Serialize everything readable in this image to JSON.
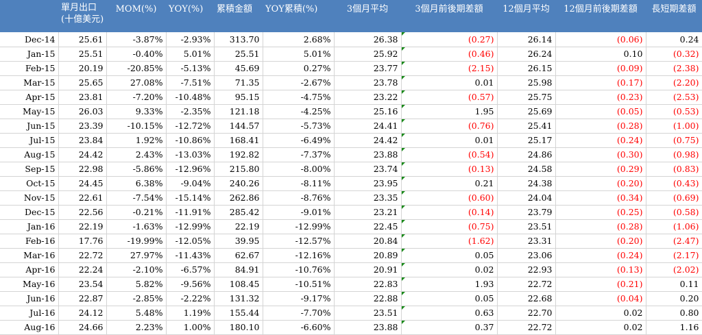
{
  "headers": [
    "",
    "單月出口\n(十億美元)",
    "MOM(%)",
    "YOY(%)",
    "累積金額",
    "YOY累積(%)",
    "3個月平均",
    "3個月前後期差額",
    "12個月平均",
    "12個月前後期差額",
    "長短期差額"
  ],
  "rows": [
    {
      "date": "Dec-14",
      "export": "25.61",
      "mom": "-3.87%",
      "yoy": "-2.93%",
      "cum": "313.70",
      "yoy_cum": "2.68%",
      "avg3": "26.38",
      "diff3": "(0.27)",
      "avg12": "26.14",
      "diff12": "(0.06)",
      "spread": "0.24"
    },
    {
      "date": "Jan-15",
      "export": "25.51",
      "mom": "-0.40%",
      "yoy": "5.01%",
      "cum": "25.51",
      "yoy_cum": "5.01%",
      "avg3": "25.92",
      "diff3": "(0.46)",
      "avg12": "26.24",
      "diff12": "0.10",
      "spread": "(0.32)"
    },
    {
      "date": "Feb-15",
      "export": "20.19",
      "mom": "-20.85%",
      "yoy": "-5.13%",
      "cum": "45.69",
      "yoy_cum": "0.27%",
      "avg3": "23.77",
      "diff3": "(2.15)",
      "avg12": "26.15",
      "diff12": "(0.09)",
      "spread": "(2.38)"
    },
    {
      "date": "Mar-15",
      "export": "25.65",
      "mom": "27.08%",
      "yoy": "-7.51%",
      "cum": "71.35",
      "yoy_cum": "-2.67%",
      "avg3": "23.78",
      "diff3": "0.01",
      "avg12": "25.98",
      "diff12": "(0.17)",
      "spread": "(2.20)"
    },
    {
      "date": "Apr-15",
      "export": "23.81",
      "mom": "-7.20%",
      "yoy": "-10.48%",
      "cum": "95.15",
      "yoy_cum": "-4.75%",
      "avg3": "23.22",
      "diff3": "(0.57)",
      "avg12": "25.75",
      "diff12": "(0.23)",
      "spread": "(2.53)"
    },
    {
      "date": "May-15",
      "export": "26.03",
      "mom": "9.33%",
      "yoy": "-2.35%",
      "cum": "121.18",
      "yoy_cum": "-4.25%",
      "avg3": "25.16",
      "diff3": "1.95",
      "avg12": "25.69",
      "diff12": "(0.05)",
      "spread": "(0.53)"
    },
    {
      "date": "Jun-15",
      "export": "23.39",
      "mom": "-10.15%",
      "yoy": "-12.72%",
      "cum": "144.57",
      "yoy_cum": "-5.73%",
      "avg3": "24.41",
      "diff3": "(0.76)",
      "avg12": "25.41",
      "diff12": "(0.28)",
      "spread": "(1.00)"
    },
    {
      "date": "Jul-15",
      "export": "23.84",
      "mom": "1.92%",
      "yoy": "-10.86%",
      "cum": "168.41",
      "yoy_cum": "-6.49%",
      "avg3": "24.42",
      "diff3": "0.01",
      "avg12": "25.17",
      "diff12": "(0.24)",
      "spread": "(0.75)"
    },
    {
      "date": "Aug-15",
      "export": "24.42",
      "mom": "2.43%",
      "yoy": "-13.03%",
      "cum": "192.82",
      "yoy_cum": "-7.37%",
      "avg3": "23.88",
      "diff3": "(0.54)",
      "avg12": "24.86",
      "diff12": "(0.30)",
      "spread": "(0.98)"
    },
    {
      "date": "Sep-15",
      "export": "22.98",
      "mom": "-5.86%",
      "yoy": "-12.96%",
      "cum": "215.80",
      "yoy_cum": "-8.00%",
      "avg3": "23.74",
      "diff3": "(0.13)",
      "avg12": "24.58",
      "diff12": "(0.29)",
      "spread": "(0.83)"
    },
    {
      "date": "Oct-15",
      "export": "24.45",
      "mom": "6.38%",
      "yoy": "-9.04%",
      "cum": "240.26",
      "yoy_cum": "-8.11%",
      "avg3": "23.95",
      "diff3": "0.21",
      "avg12": "24.38",
      "diff12": "(0.20)",
      "spread": "(0.43)"
    },
    {
      "date": "Nov-15",
      "export": "22.61",
      "mom": "-7.54%",
      "yoy": "-15.14%",
      "cum": "262.86",
      "yoy_cum": "-8.76%",
      "avg3": "23.35",
      "diff3": "(0.60)",
      "avg12": "24.04",
      "diff12": "(0.34)",
      "spread": "(0.69)"
    },
    {
      "date": "Dec-15",
      "export": "22.56",
      "mom": "-0.21%",
      "yoy": "-11.91%",
      "cum": "285.42",
      "yoy_cum": "-9.01%",
      "avg3": "23.21",
      "diff3": "(0.14)",
      "avg12": "23.79",
      "diff12": "(0.25)",
      "spread": "(0.58)"
    },
    {
      "date": "Jan-16",
      "export": "22.19",
      "mom": "-1.63%",
      "yoy": "-12.99%",
      "cum": "22.19",
      "yoy_cum": "-12.99%",
      "avg3": "22.45",
      "diff3": "(0.75)",
      "avg12": "23.51",
      "diff12": "(0.28)",
      "spread": "(1.06)"
    },
    {
      "date": "Feb-16",
      "export": "17.76",
      "mom": "-19.99%",
      "yoy": "-12.05%",
      "cum": "39.95",
      "yoy_cum": "-12.57%",
      "avg3": "20.84",
      "diff3": "(1.62)",
      "avg12": "23.31",
      "diff12": "(0.20)",
      "spread": "(2.47)"
    },
    {
      "date": "Mar-16",
      "export": "22.72",
      "mom": "27.97%",
      "yoy": "-11.43%",
      "cum": "62.67",
      "yoy_cum": "-12.16%",
      "avg3": "20.89",
      "diff3": "0.05",
      "avg12": "23.06",
      "diff12": "(0.24)",
      "spread": "(2.17)"
    },
    {
      "date": "Apr-16",
      "export": "22.24",
      "mom": "-2.10%",
      "yoy": "-6.57%",
      "cum": "84.91",
      "yoy_cum": "-10.76%",
      "avg3": "20.91",
      "diff3": "0.02",
      "avg12": "22.93",
      "diff12": "(0.13)",
      "spread": "(2.02)"
    },
    {
      "date": "May-16",
      "export": "23.54",
      "mom": "5.82%",
      "yoy": "-9.56%",
      "cum": "108.45",
      "yoy_cum": "-10.51%",
      "avg3": "22.83",
      "diff3": "1.93",
      "avg12": "22.72",
      "diff12": "(0.21)",
      "spread": "0.11"
    },
    {
      "date": "Jun-16",
      "export": "22.87",
      "mom": "-2.85%",
      "yoy": "-2.22%",
      "cum": "131.32",
      "yoy_cum": "-9.17%",
      "avg3": "22.88",
      "diff3": "0.05",
      "avg12": "22.68",
      "diff12": "(0.04)",
      "spread": "0.20"
    },
    {
      "date": "Jul-16",
      "export": "24.12",
      "mom": "5.48%",
      "yoy": "1.19%",
      "cum": "155.44",
      "yoy_cum": "-7.70%",
      "avg3": "23.51",
      "diff3": "0.63",
      "avg12": "22.70",
      "diff12": "0.02",
      "spread": "0.80"
    },
    {
      "date": "Aug-16",
      "export": "24.66",
      "mom": "2.23%",
      "yoy": "1.00%",
      "cum": "180.10",
      "yoy_cum": "-6.60%",
      "avg3": "23.88",
      "diff3": "0.37",
      "avg12": "22.72",
      "diff12": "0.02",
      "spread": "1.16"
    }
  ],
  "colors": {
    "header_bg": "#4f81bd",
    "header_text": "#ffffff",
    "negative_text": "#ff0000",
    "gridline": "#d4d4d4",
    "error_indicator": "#1a8a1a"
  }
}
